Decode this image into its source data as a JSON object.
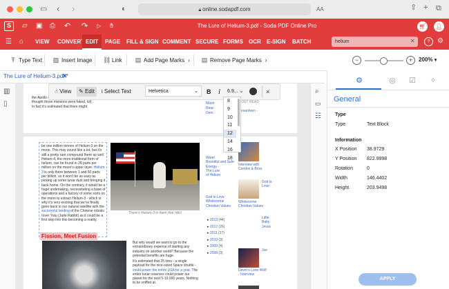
{
  "browser": {
    "url": "online.sodapdf.com",
    "aa_label": "AA"
  },
  "app": {
    "logo_letter": "S",
    "title": "The Lure of Helium-3.pdf - Soda PDF Online Pro",
    "menu": [
      "VIEW",
      "CONVERT",
      "EDIT",
      "PAGE",
      "FILL & SIGN",
      "COMMENT",
      "SECURE",
      "FORMS",
      "OCR",
      "E-SIGN",
      "BATCH"
    ],
    "active_menu": "EDIT",
    "search_value": "helium"
  },
  "toolbar": {
    "type_text": "Type Text",
    "insert_image": "Insert Image",
    "link": "Link",
    "add_page_marks": "Add Page Marks",
    "remove_page_marks": "Remove Page Marks",
    "zoom": "200%"
  },
  "doc_tab": {
    "name": "The Lure of Helium-3.pdf",
    "modified_mark": "*"
  },
  "float_bar": {
    "view": "View",
    "edit": "Edit",
    "select_text": "Select Text",
    "font": "Helvetica",
    "bold": "B",
    "italic": "I",
    "size": "6.9...",
    "close": "×"
  },
  "size_options": [
    "8",
    "9",
    "10",
    "11",
    "12",
    "14",
    "16",
    "18"
  ],
  "size_selected": "12",
  "page": {
    "top_text": "the Apollo missions (and some of you thought those missions were faked, lol). In fact it's estimated that there might",
    "body_text_1": "be one million tonnes of Helium-3 on the moon. This may sound like a lot, but it's still a pretty rare compound there as well. Helium-4, the more traditional form of helium, can be found in 28 parts per million on the moon's upper layer.",
    "body_link_1": "Helium-3",
    "body_text_2": "is only there between 1 and 50 parts per billion, so it won't be as easy as picking up some lunar dust and bringing it back home.",
    "body_text_3": "On the contrary, it would be a huge undertaking, necessitating a base of operations and a factory of some sorts on the moon to extract Helium-3 - which is why it's very exciting that we've finally gone back to our natural satellite with the",
    "body_link_2": "successful landing",
    "body_text_4": "of the Chinese robotic rover Yutu (Jade Rabbit) as it could be a first step into this becoming a reality.",
    "heading": "Fission, Meet Fusion",
    "caption": "There's Helium-3 in them thar hills!",
    "lower_text_1": "But why would we want to go to the extraordinary expense of starting any industry on another world? Because the potential benefits are huge.",
    "lower_text_2": "It's estimated that 25 tons - a single payload for the nice-sized Space shuttle -",
    "lower_link": "could power the entire USA for a year.",
    "lower_text_3": "The entire lunar reserves could power our planet for the next 5-10,000 years. Nothing to be sniffed at.",
    "side_top_1": "Mach",
    "side_top_2": "Reac",
    "side_top_3": "Dem",
    "most_read": "MOST READ",
    "oceanhorn": "Oceanhorn -",
    "side_mid": [
      "Water",
      "Bountiful and Safe",
      "Energy -",
      "The Lure",
      "of Helium"
    ],
    "god_is_love_a": "God is Love: Wholesome Christian Values",
    "archive": [
      {
        "year": "2013",
        "count": "(44)"
      },
      {
        "year": "2012",
        "count": "(26)"
      },
      {
        "year": "2011",
        "count": "(17)"
      },
      {
        "year": "2010",
        "count": "(3)"
      },
      {
        "year": "2009",
        "count": "(4)"
      },
      {
        "year": "2008",
        "count": "(3)"
      }
    ],
    "thumbs": [
      {
        "label": "Interview with Comfox & Broa"
      },
      {
        "label": "Wholesome Christian Values"
      },
      {
        "label": "Dever's Lone Wolf - Interview"
      }
    ],
    "thumb_side": [
      "God is Love:",
      "Little Baby Jesus",
      "Joe"
    ]
  },
  "panel": {
    "title": "General",
    "type_section": "Type",
    "type_label": "Type",
    "type_value": "Text Block",
    "info_section": "Information",
    "rows": [
      {
        "label": "X Position",
        "value": "38.9729"
      },
      {
        "label": "Y Position",
        "value": "822.9998"
      },
      {
        "label": "Rotation",
        "value": "0"
      },
      {
        "label": "Width",
        "value": "146.4402"
      },
      {
        "label": "Height",
        "value": "203.9498"
      }
    ],
    "apply": "APPLY"
  },
  "colors": {
    "brand_red": "#e23d3d",
    "panel_blue": "#2f6fd0",
    "apply_blue": "#9fc0ee",
    "heading_red": "#d02020"
  }
}
